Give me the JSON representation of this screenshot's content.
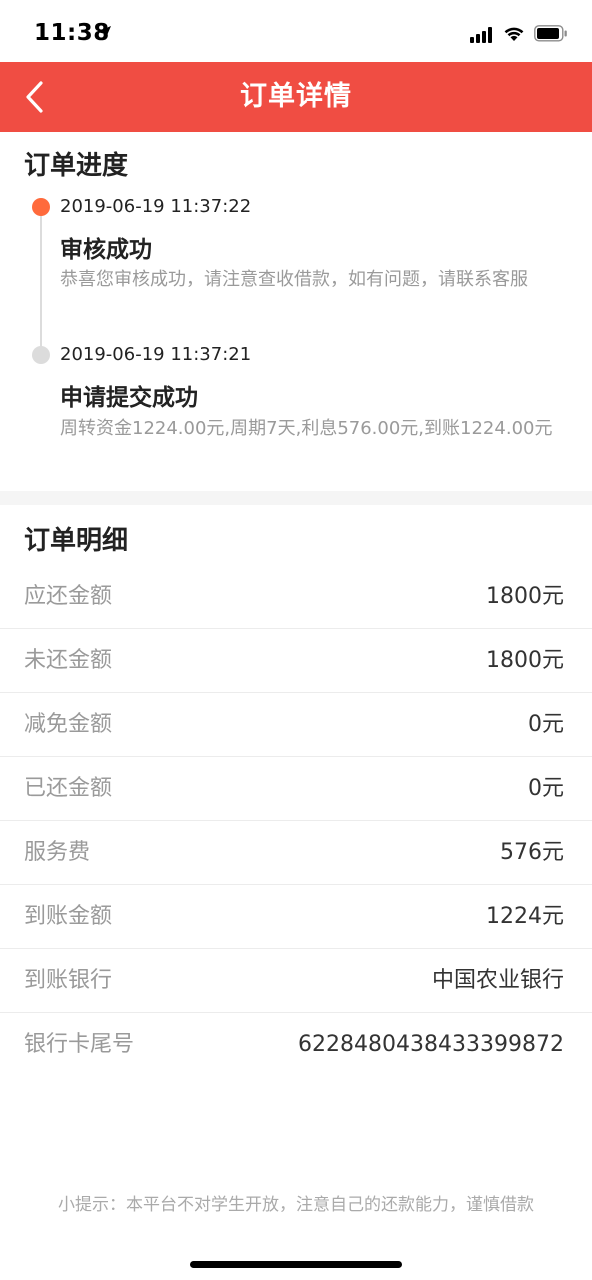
{
  "status_bar": {
    "time": "11:38"
  },
  "nav": {
    "title": "订单详情"
  },
  "progress": {
    "title": "订单进度",
    "events": [
      {
        "time": "2019-06-19 11:37:22",
        "status": "审核成功",
        "desc": "恭喜您审核成功，请注意查收借款，如有问题，请联系客服"
      },
      {
        "time": "2019-06-19 11:37:21",
        "status": "申请提交成功",
        "desc": "周转资金1224.00元,周期7天,利息576.00元,到账1224.00元"
      }
    ]
  },
  "details": {
    "title": "订单明细",
    "rows": [
      {
        "label": "应还金额",
        "value": "1800元"
      },
      {
        "label": "未还金额",
        "value": "1800元"
      },
      {
        "label": "减免金额",
        "value": "0元"
      },
      {
        "label": "已还金额",
        "value": "0元"
      },
      {
        "label": "服务费",
        "value": "576元"
      },
      {
        "label": "到账金额",
        "value": "1224元"
      },
      {
        "label": "到账银行",
        "value": "中国农业银行"
      },
      {
        "label": "银行卡尾号",
        "value": "6228480438433399872"
      }
    ]
  },
  "footer": {
    "tip": "小提示：本平台不对学生开放，注意自己的还款能力，谨慎借款"
  },
  "colors": {
    "nav_background": "#f04d43",
    "active_dot": "#ff6a3c",
    "inactive_dot": "#dcdcdc"
  },
  "icons": {
    "back": "chevron-left-icon",
    "location": "location-arrow-icon",
    "signal": "cellular-signal-icon",
    "wifi": "wifi-icon",
    "battery": "battery-icon"
  }
}
